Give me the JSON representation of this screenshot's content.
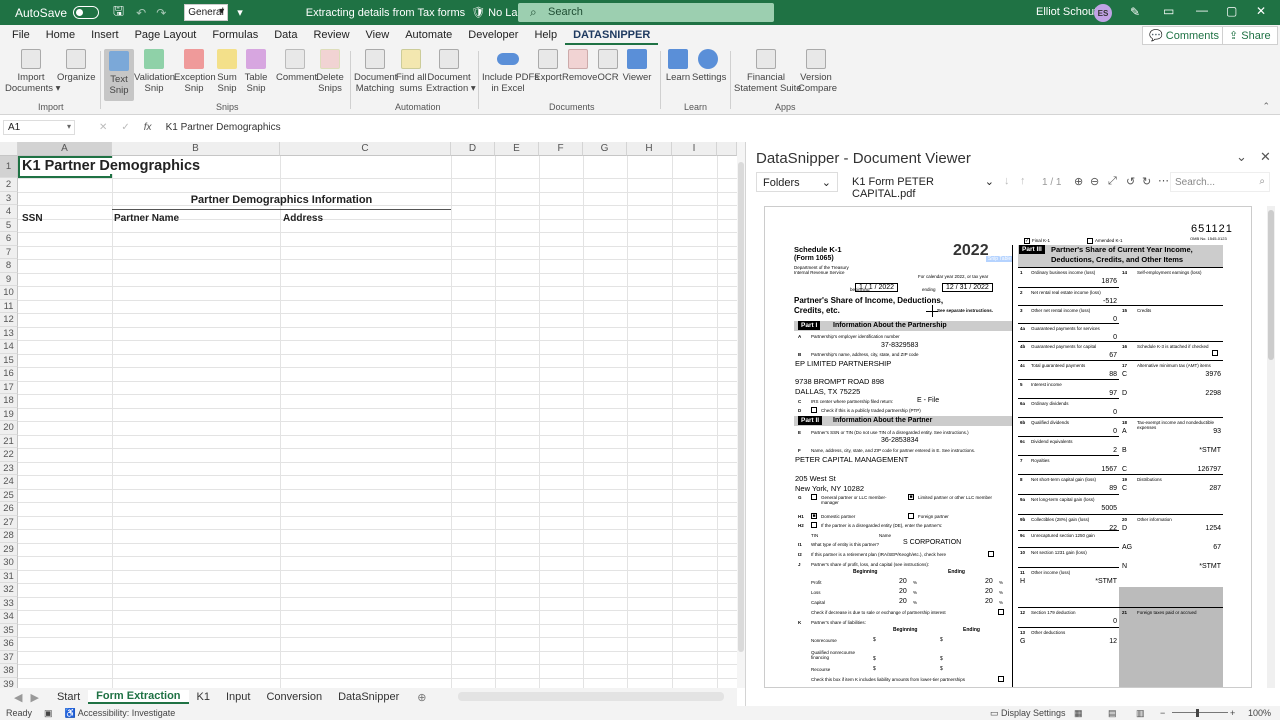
{
  "titlebar": {
    "autosave": "AutoSave",
    "format": "General",
    "doc_title": "Extracting details from Tax forms",
    "label": "No Label",
    "search": "Search",
    "user": "Elliot Schouten",
    "user_initials": "ES"
  },
  "menu": [
    "File",
    "Home",
    "Insert",
    "Page Layout",
    "Formulas",
    "Data",
    "Review",
    "View",
    "Automate",
    "Developer",
    "Help",
    "DATASNIPPER"
  ],
  "menu_right": {
    "comments": "Comments",
    "share": "Share"
  },
  "ribbon": {
    "buttons": [
      {
        "label": "Import\nDocuments ▾"
      },
      {
        "label": "Organize"
      },
      {
        "label": "Text\nSnip"
      },
      {
        "label": "Validation\nSnip"
      },
      {
        "label": "Exception\nSnip"
      },
      {
        "label": "Sum\nSnip"
      },
      {
        "label": "Table\nSnip"
      },
      {
        "label": "Comment"
      },
      {
        "label": "Delete\nSnips"
      },
      {
        "label": "Document\nMatching"
      },
      {
        "label": "Find all\nsums"
      },
      {
        "label": "Document\nExtraction ▾"
      },
      {
        "label": "Include PDFs\nin Excel"
      },
      {
        "label": "Export"
      },
      {
        "label": "Remove"
      },
      {
        "label": "OCR"
      },
      {
        "label": "Viewer"
      },
      {
        "label": "Learn"
      },
      {
        "label": "Settings"
      },
      {
        "label": "Financial\nStatement Suite"
      },
      {
        "label": "Version\nCompare"
      }
    ],
    "groups": [
      "Import",
      "Snips",
      "Automation",
      "Documents",
      "Learn",
      "Apps"
    ]
  },
  "formula_bar": {
    "cell": "A1",
    "content": "K1 Partner Demographics"
  },
  "sheet": {
    "columns": [
      "A",
      "B",
      "C",
      "D",
      "E",
      "F",
      "G",
      "H",
      "I"
    ],
    "rows": [
      "1",
      "2",
      "3",
      "4",
      "5",
      "6",
      "7",
      "8",
      "9",
      "10",
      "11",
      "12",
      "13",
      "14",
      "15",
      "16",
      "17",
      "18",
      "19",
      "20",
      "21",
      "22",
      "23",
      "24",
      "25",
      "26",
      "27",
      "28",
      "29",
      "30",
      "31",
      "32",
      "33",
      "34",
      "35",
      "36",
      "37",
      "38",
      "39"
    ],
    "title": "K1 Partner Demographics",
    "section_header": "Partner Demographics Information",
    "col_headers": [
      "SSN",
      "Partner Name",
      "Address"
    ]
  },
  "sheet_tabs": [
    "Start",
    "Form Extraction",
    "K1",
    "Input",
    "Conversion",
    "DataSnipper"
  ],
  "active_tab": "Form Extraction",
  "statusbar": {
    "ready": "Ready",
    "accessibility": "Accessibility: Investigate",
    "display": "Display Settings",
    "zoom": "100%"
  },
  "viewer": {
    "title": "DataSnipper - Document Viewer",
    "folders": "Folders",
    "file": "K1 Form PETER CAPITAL.pdf",
    "page": "1 / 1",
    "search": "Search...",
    "doc": {
      "code": "651121",
      "omb": "OMB No. 1545-0123",
      "year": "2022",
      "schedule": "Schedule K-1",
      "form": "(Form 1065)",
      "dept": "Department of the Treasury",
      "irs": "Internal Revenue Service",
      "cal_year": "For calendar year 2022, or tax year",
      "begin_label": "beginning",
      "begin_date": "1 / 1 / 2022",
      "end_label": "ending",
      "end_date": "12 / 31 / 2022",
      "heading1": "Partner's Share of Income, Deductions,",
      "heading2": "Credits, etc.",
      "see_instr": "See separate instructions.",
      "part1": "Part I",
      "part1_title": "Information About the Partnership",
      "lineA": "Partnership's employer identification number",
      "ein": "37-8329583",
      "lineB": "Partnership's name, address, city, state, and ZIP code",
      "p_name": "EP LIMITED PARTNERSHIP",
      "p_addr1": "9738 BROMPT ROAD 898",
      "p_addr2": "DALLAS, TX 75225",
      "lineC": "IRS center where partnership filed return:",
      "irs_center": "E - File",
      "lineD": "Check if this is a publicly traded partnership (PTP)",
      "part2": "Part II",
      "part2_title": "Information About the Partner",
      "lineE": "Partner's SSN or TIN (Do not use TIN of a disregarded entity. See instructions.)",
      "ssn": "36-2853834",
      "lineF": "Name, address, city, state, and ZIP code for partner entered in E. See instructions.",
      "partner_name": "PETER CAPITAL MANAGEMENT",
      "partner_addr1": "205 West St",
      "partner_addr2": "New York, NY 10282",
      "g1": "General partner or LLC member-manager",
      "g2": "Limited partner or other LLC member",
      "h1": "Domestic partner",
      "h1b": "Foreign partner",
      "h2": "If the partner is a disregarded entity (DE), enter the partner's:",
      "tin": "TIN",
      "name_lbl": "Name",
      "i1": "What type of entity is this partner?",
      "entity": "S CORPORATION",
      "i2": "If this partner is a retirement plan (IRA/SEP/Keogh/etc.), check here",
      "j": "Partner's share of profit, loss, and capital (see instructions):",
      "beginning": "Beginning",
      "ending": "Ending",
      "profit": "Profit",
      "loss": "Loss",
      "capital": "Capital",
      "pct": "20",
      "pct_sym": "%",
      "check_decrease": "Check if decrease is due to sale or exchange of partnership interest",
      "k": "Partner's share of liabilities:",
      "nonrecourse": "Nonrecourse",
      "qual_nonrec": "Qualified nonrecourse financing",
      "recourse": "Recourse",
      "dollar": "$",
      "check_k": "Check this box if item K includes liability amounts from lower-tier partnerships",
      "final": "Final K-1",
      "amended": "Amended K-1",
      "part3": "Part III",
      "part3_title1": "Partner's Share of Current Year Income,",
      "part3_title2": "Deductions, Credits, and Other Items",
      "snip_tag": "Snip Table",
      "left_lines": [
        {
          "num": "1",
          "label": "Ordinary business income (loss)",
          "val": "1876"
        },
        {
          "num": "2",
          "label": "Net rental real estate income (loss)",
          "val": "-512"
        },
        {
          "num": "3",
          "label": "Other net rental income (loss)",
          "val": "0"
        },
        {
          "num": "4a",
          "label": "Guaranteed payments for services",
          "val": "0"
        },
        {
          "num": "4b",
          "label": "Guaranteed payments for capital",
          "val": "67"
        },
        {
          "num": "4c",
          "label": "Total guaranteed payments",
          "val": "88"
        },
        {
          "num": "5",
          "label": "Interest income",
          "val": "97"
        },
        {
          "num": "6a",
          "label": "Ordinary dividends",
          "val": "0"
        },
        {
          "num": "6b",
          "label": "Qualified dividends",
          "val": "0"
        },
        {
          "num": "6c",
          "label": "Dividend equivalents",
          "val": "2"
        },
        {
          "num": "7",
          "label": "Royalties",
          "val": "1567"
        },
        {
          "num": "8",
          "label": "Net short-term capital gain (loss)",
          "val": "89"
        },
        {
          "num": "9a",
          "label": "Net long-term capital gain (loss)",
          "val": "5005"
        },
        {
          "num": "9b",
          "label": "Collectibles (28%) gain (loss)",
          "val": "22"
        },
        {
          "num": "9c",
          "label": "Unrecaptured section 1250 gain",
          "val": ""
        },
        {
          "num": "10",
          "label": "Net section 1231 gain (loss)",
          "val": ""
        },
        {
          "num": "11",
          "label": "Other income (loss)",
          "code": "H",
          "val": "*STMT"
        },
        {
          "num": "12",
          "label": "Section 179 deduction",
          "val": "0"
        },
        {
          "num": "13",
          "label": "Other deductions",
          "code": "G",
          "val": "12"
        }
      ],
      "right_lines": [
        {
          "num": "14",
          "label": "Self-employment earnings (loss)",
          "code": "",
          "val": ""
        },
        {
          "num": "15",
          "label": "Credits",
          "code": "",
          "val": ""
        },
        {
          "num": "16",
          "label": "Schedule K-3 is attached if checked",
          "code": "",
          "val": ""
        },
        {
          "num": "17",
          "label": "Alternative minimum tax (AMT) items",
          "code": "C",
          "val": "3976"
        },
        {
          "num": "",
          "label": "",
          "code": "D",
          "val": "2298"
        },
        {
          "num": "18",
          "label": "Tax-exempt income and nondeductible expenses",
          "code": "A",
          "val": "93"
        },
        {
          "num": "",
          "label": "",
          "code": "B",
          "val": "*STMT"
        },
        {
          "num": "",
          "label": "",
          "code": "C",
          "val": "126797"
        },
        {
          "num": "19",
          "label": "Distributions",
          "code": "C",
          "val": "287"
        },
        {
          "num": "20",
          "label": "Other information",
          "code": "D",
          "val": "1254"
        },
        {
          "num": "",
          "label": "",
          "code": "AG",
          "val": "67"
        },
        {
          "num": "",
          "label": "",
          "code": "N",
          "val": "*STMT"
        },
        {
          "num": "21",
          "label": "Foreign taxes paid or accrued",
          "code": "",
          "val": ""
        }
      ]
    }
  }
}
